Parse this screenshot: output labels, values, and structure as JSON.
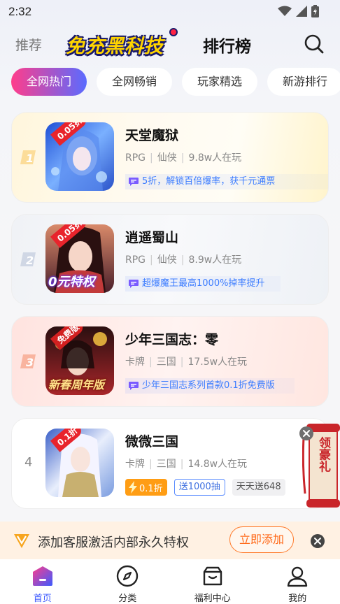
{
  "status_bar": {
    "time": "2:32"
  },
  "header": {
    "tab_recommend": "推荐",
    "logo_text": "免充黑科技",
    "tab_ranking": "排行榜"
  },
  "chips": [
    {
      "label": "全网热门",
      "active": true
    },
    {
      "label": "全网畅销",
      "active": false
    },
    {
      "label": "玩家精选",
      "active": false
    },
    {
      "label": "新游排行",
      "active": false
    }
  ],
  "games": [
    {
      "rank": "1",
      "name": "天堂魔狱",
      "genre": "RPG",
      "theme": "仙侠",
      "players": "9.8w人在玩",
      "cover_tag": "0.05折",
      "cover_banner": "",
      "promo": "5折，解锁百倍爆率，获千元通票"
    },
    {
      "rank": "2",
      "name": "逍遥蜀山",
      "genre": "RPG",
      "theme": "仙侠",
      "players": "8.9w人在玩",
      "cover_tag": "0.05折",
      "cover_banner": "0元特权",
      "promo": "超爆魔王最高1000%掉率提升"
    },
    {
      "rank": "3",
      "name": "少年三国志：零",
      "genre": "卡牌",
      "theme": "三国",
      "players": "17.5w人在玩",
      "cover_tag": "免费版",
      "cover_banner": "新春周年版",
      "promo": "少年三国志系列首款0.1折免费版"
    },
    {
      "rank": "4",
      "name": "微微三国",
      "genre": "卡牌",
      "theme": "三国",
      "players": "14.8w人在玩",
      "cover_tag": "0.1折",
      "cover_banner": "",
      "discount": "0.1折",
      "gift": "送1000抽",
      "daily": "天天送648"
    }
  ],
  "float_gift": {
    "label": "领豪礼"
  },
  "banner": {
    "text": "添加客服激活内部永久特权",
    "button": "立即添加"
  },
  "bottom_nav": [
    {
      "label": "首页",
      "icon": "home-icon",
      "active": true
    },
    {
      "label": "分类",
      "icon": "compass-icon",
      "active": false
    },
    {
      "label": "福利中心",
      "icon": "gift-box-icon",
      "active": false
    },
    {
      "label": "我的",
      "icon": "profile-icon",
      "active": false
    }
  ],
  "colors": {
    "accent": "#3d5aff",
    "chip_gradient_start": "#ff3d8b",
    "chip_gradient_end": "#5a6bff",
    "promo_text": "#3d7dff",
    "discount_orange": "#ff9d14",
    "banner_bg": "#fff1e3"
  }
}
